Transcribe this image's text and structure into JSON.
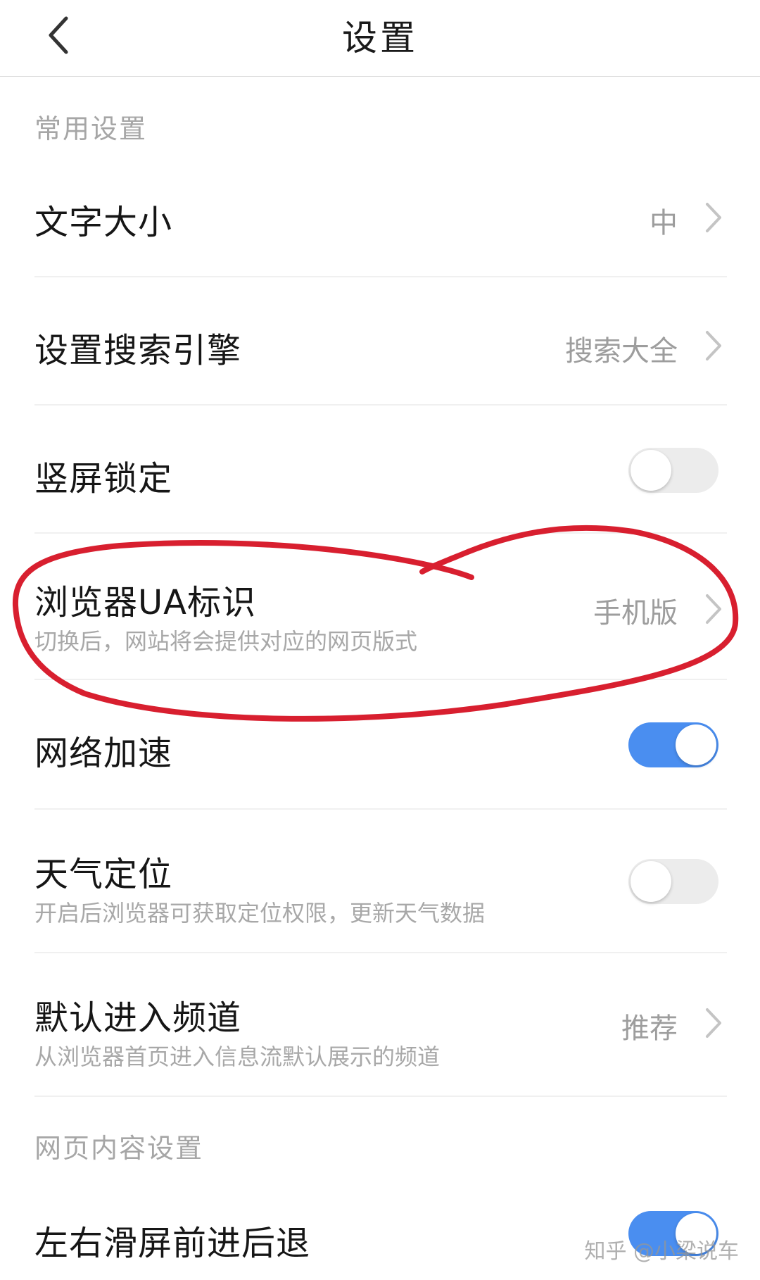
{
  "header": {
    "title": "设置"
  },
  "sections": {
    "common": "常用设置",
    "web_content": "网页内容设置"
  },
  "rows": {
    "font_size": {
      "title": "文字大小",
      "value": "中"
    },
    "search_engine": {
      "title": "设置搜索引擎",
      "value": "搜索大全"
    },
    "portrait_lock": {
      "title": "竖屏锁定",
      "toggle": false
    },
    "browser_ua": {
      "title": "浏览器UA标识",
      "subtitle": "切换后，网站将会提供对应的网页版式",
      "value": "手机版"
    },
    "network_accel": {
      "title": "网络加速",
      "toggle": true
    },
    "weather_location": {
      "title": "天气定位",
      "subtitle": "开启后浏览器可获取定位权限，更新天气数据",
      "toggle": false
    },
    "default_channel": {
      "title": "默认进入频道",
      "subtitle": "从浏览器首页进入信息流默认展示的频道",
      "value": "推荐"
    },
    "swipe_nav": {
      "title": "左右滑屏前进后退",
      "toggle": true
    }
  },
  "watermark": "知乎 @小梁说车",
  "colors": {
    "accent": "#4a8ef0",
    "annotation": "#d81f2f",
    "secondary_text": "#a6a6a6"
  }
}
